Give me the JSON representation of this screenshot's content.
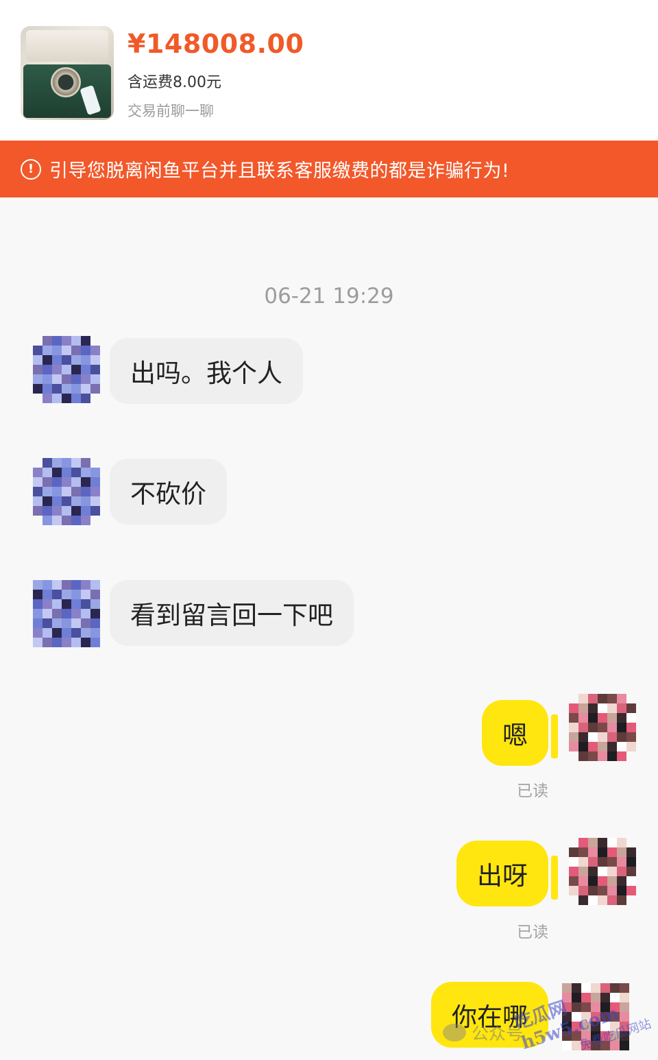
{
  "product": {
    "price": "¥148008.00",
    "shipping": "含运费8.00元",
    "note": "交易前聊一聊",
    "image_icon": "watch-box-thumbnail"
  },
  "warning": {
    "icon": "exclamation-circle-icon",
    "text": "引导您脱离闲鱼平台并且联系客服缴费的都是诈骗行为!"
  },
  "chat": {
    "timestamp": "06-21 19:29",
    "incoming": [
      {
        "text": "出吗。我个人"
      },
      {
        "text": "不砍价"
      },
      {
        "text": "看到留言回一下吧"
      }
    ],
    "outgoing": [
      {
        "text": "嗯",
        "status": "已读"
      },
      {
        "text": "出呀",
        "status": "已读"
      },
      {
        "text": "你在哪"
      }
    ]
  },
  "watermarks": {
    "wechat": "公众号",
    "site_line1": "吃瓜网h5w5.com",
    "site_line2": "免费吃瓜网站"
  },
  "colors": {
    "price": "#f05a28",
    "banner": "#f2582a",
    "outgoing_bubble": "#ffe60f",
    "incoming_bubble": "#efefef"
  }
}
